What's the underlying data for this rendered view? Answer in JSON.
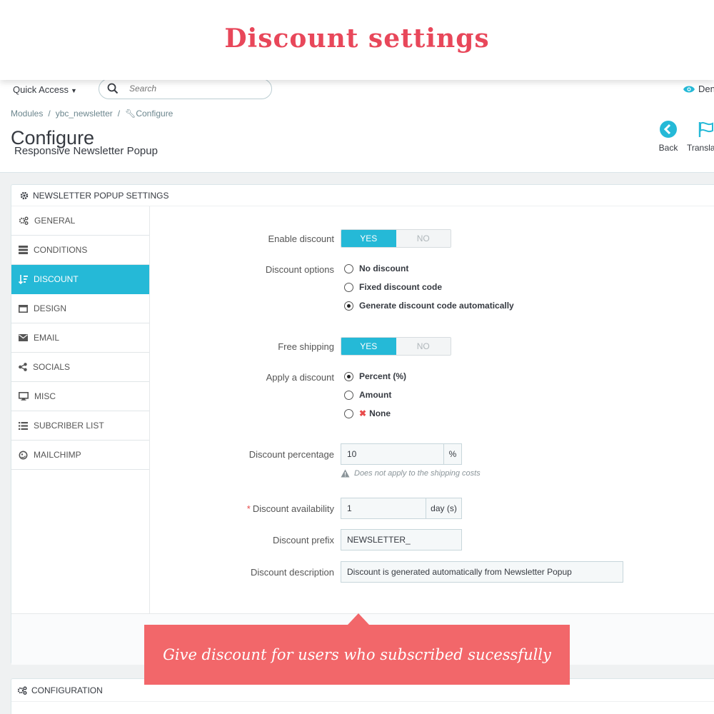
{
  "banner": {
    "title": "Discount settings"
  },
  "topbar": {
    "quick_access": "Quick Access",
    "search_placeholder": "Search",
    "demo_label": "Den"
  },
  "breadcrumb": {
    "items": [
      "Modules",
      "ybc_newsletter",
      "Configure"
    ]
  },
  "page": {
    "title": "Configure",
    "subtitle": "Responsive Newsletter Popup",
    "tools": {
      "back": "Back",
      "translate": "Transla"
    }
  },
  "panel": {
    "heading": "NEWSLETTER POPUP SETTINGS",
    "sidebar": [
      {
        "label": "GENERAL",
        "icon": "cogs-icon",
        "active": false
      },
      {
        "label": "CONDITIONS",
        "icon": "server-icon",
        "active": false
      },
      {
        "label": "DISCOUNT",
        "icon": "sort-amount-icon",
        "active": true
      },
      {
        "label": "DESIGN",
        "icon": "window-icon",
        "active": false
      },
      {
        "label": "EMAIL",
        "icon": "envelope-icon",
        "active": false
      },
      {
        "label": "SOCIALS",
        "icon": "share-icon",
        "active": false
      },
      {
        "label": "MISC",
        "icon": "desktop-icon",
        "active": false
      },
      {
        "label": "SUBCRIBER LIST",
        "icon": "list-icon",
        "active": false
      },
      {
        "label": "MAILCHIMP",
        "icon": "mailchimp-icon",
        "active": false
      }
    ]
  },
  "form": {
    "enable_discount": {
      "label": "Enable discount",
      "yes": "YES",
      "no": "NO",
      "value": "YES"
    },
    "discount_options": {
      "label": "Discount options",
      "options": [
        "No discount",
        "Fixed discount code",
        "Generate discount code automatically"
      ],
      "selected": 2
    },
    "free_shipping": {
      "label": "Free shipping",
      "yes": "YES",
      "no": "NO",
      "value": "YES"
    },
    "apply_discount": {
      "label": "Apply a discount",
      "options": [
        "Percent (%)",
        "Amount",
        "None"
      ],
      "selected": 0
    },
    "discount_percentage": {
      "label": "Discount percentage",
      "value": "10",
      "unit": "%",
      "hint": "Does not apply to the shipping costs"
    },
    "discount_availability": {
      "label": "Discount availability",
      "required_mark": "*",
      "value": "1",
      "unit": "day (s)"
    },
    "discount_prefix": {
      "label": "Discount prefix",
      "value": "NEWSLETTER_"
    },
    "discount_description": {
      "label": "Discount description",
      "value": "Discount is generated automatically from Newsletter Popup"
    }
  },
  "config_panel": {
    "heading": "CONFIGURATION"
  },
  "callout": {
    "text": "Give discount for users who subscribed sucessfully"
  },
  "colors": {
    "accent": "#25b9d7",
    "banner_title": "#e8475a",
    "callout_bg": "#f2676a"
  }
}
